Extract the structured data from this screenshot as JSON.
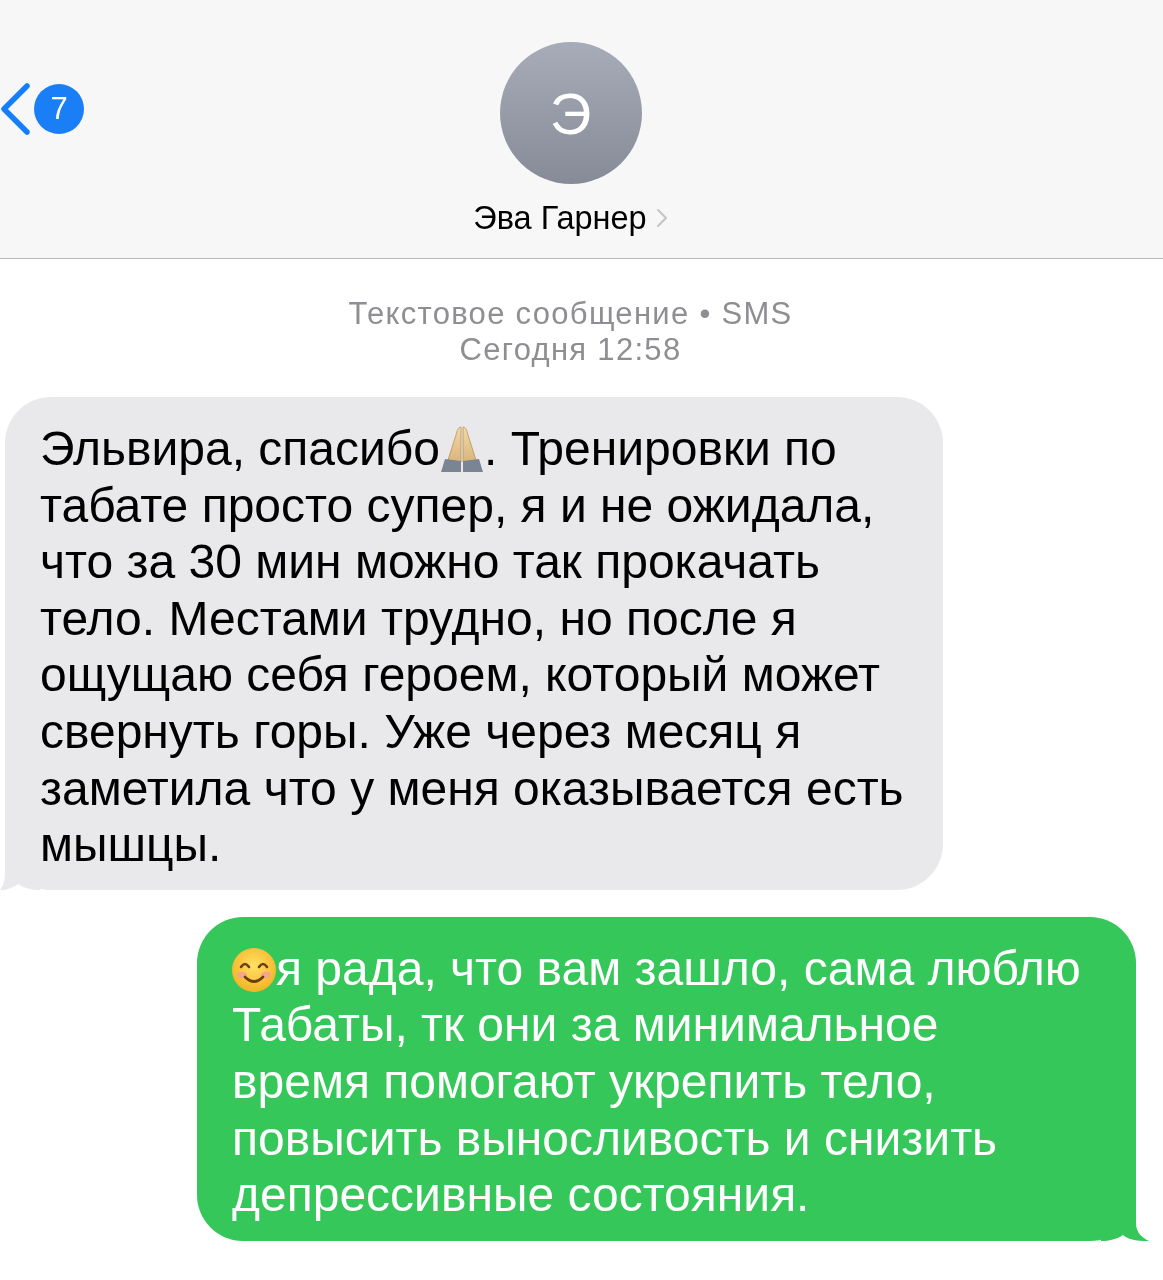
{
  "header": {
    "back": {
      "badge": "7"
    },
    "contact": {
      "initial": "Э",
      "name": "Эва Гарнер"
    }
  },
  "thread": {
    "service": "Текстовое сообщение • SMS",
    "timestamp": "Сегодня 12:58"
  },
  "messages": [
    {
      "kind": "incoming",
      "segments": [
        {
          "kind": "text",
          "text": "Эльвира, спасибо"
        },
        {
          "kind": "hands"
        },
        {
          "kind": "text",
          "text": ". Тренировки по табате просто супер, я и не ожидала, что за 30 мин можно так прокачать тело. Местами трудно, но после я ощущаю себя героем, который может свернуть горы. Уже через месяц я заметила что у меня оказывается есть мышцы."
        }
      ]
    },
    {
      "kind": "outgoing",
      "segments": [
        {
          "kind": "smile"
        },
        {
          "kind": "text",
          "text": "я рада, что вам зашло, сама люблю Табаты, тк они за минимальное время помогают укрепить тело, повысить выносливость и снизить депрессивные состояния."
        }
      ]
    }
  ]
}
